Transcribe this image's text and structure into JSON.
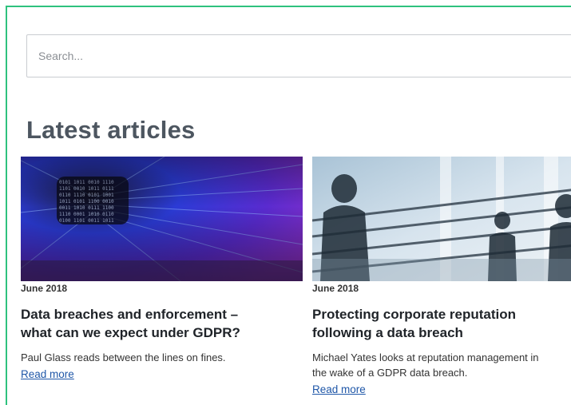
{
  "search": {
    "placeholder": "Search..."
  },
  "section": {
    "title": "Latest articles"
  },
  "articles": [
    {
      "image": "digital-code-tunnel-image",
      "date": "June 2018",
      "headline_line1": "Data breaches and enforcement –",
      "headline_line2": "what can we expect under GDPR?",
      "summary_line1": "Paul Glass reads between the lines on fines.",
      "summary_line2": "",
      "read_more": "Read more"
    },
    {
      "image": "office-meeting-silhouettes-image",
      "date": "June 2018",
      "headline_line1": "Protecting corporate reputation",
      "headline_line2": "following a data breach",
      "summary_line1": "Michael Yates looks at reputation management in",
      "summary_line2": "the wake of a GDPR data breach.",
      "read_more": "Read more"
    }
  ],
  "colors": {
    "frame_border": "#2ec27e",
    "title": "#4d5660",
    "link": "#1f57a8"
  }
}
